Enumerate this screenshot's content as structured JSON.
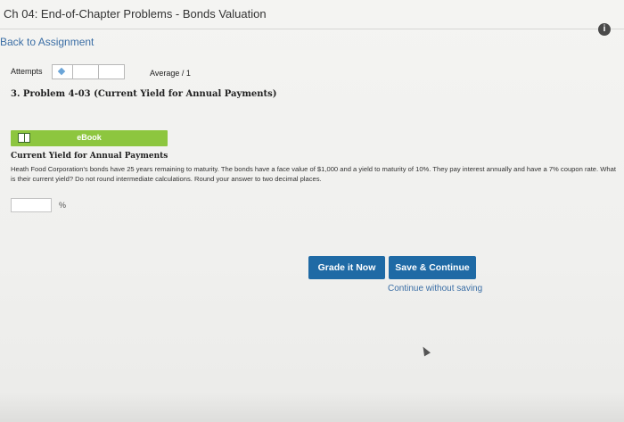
{
  "header": {
    "title": "Ch 04: End-of-Chapter Problems - Bonds Valuation",
    "info_icon": "info-icon",
    "info_glyph": "i"
  },
  "nav": {
    "back_label": "Back to Assignment"
  },
  "attempts": {
    "label": "Attempts",
    "icon": "diamond-icon",
    "average_label": "Average / 1"
  },
  "problem": {
    "title": "3. Problem 4-03 (Current Yield for Annual Payments)",
    "ebook_label": "eBook",
    "ebook_icon": "book-icon",
    "heading": "Current Yield for Annual Payments",
    "text": "Heath Food Corporation's bonds have 25 years remaining to maturity. The bonds have a face value of $1,000 and a yield to maturity of 10%. They pay interest annually and have a 7% coupon rate. What is their current yield? Do not round intermediate calculations. Round your answer to two decimal places.",
    "answer_value": "",
    "unit": "%"
  },
  "actions": {
    "grade_label": "Grade it Now",
    "save_label": "Save & Continue",
    "continue_label": "Continue without saving"
  },
  "colors": {
    "accent": "#1f6aa5",
    "ebook_green": "#8dc63f",
    "link": "#3b6ea5"
  }
}
